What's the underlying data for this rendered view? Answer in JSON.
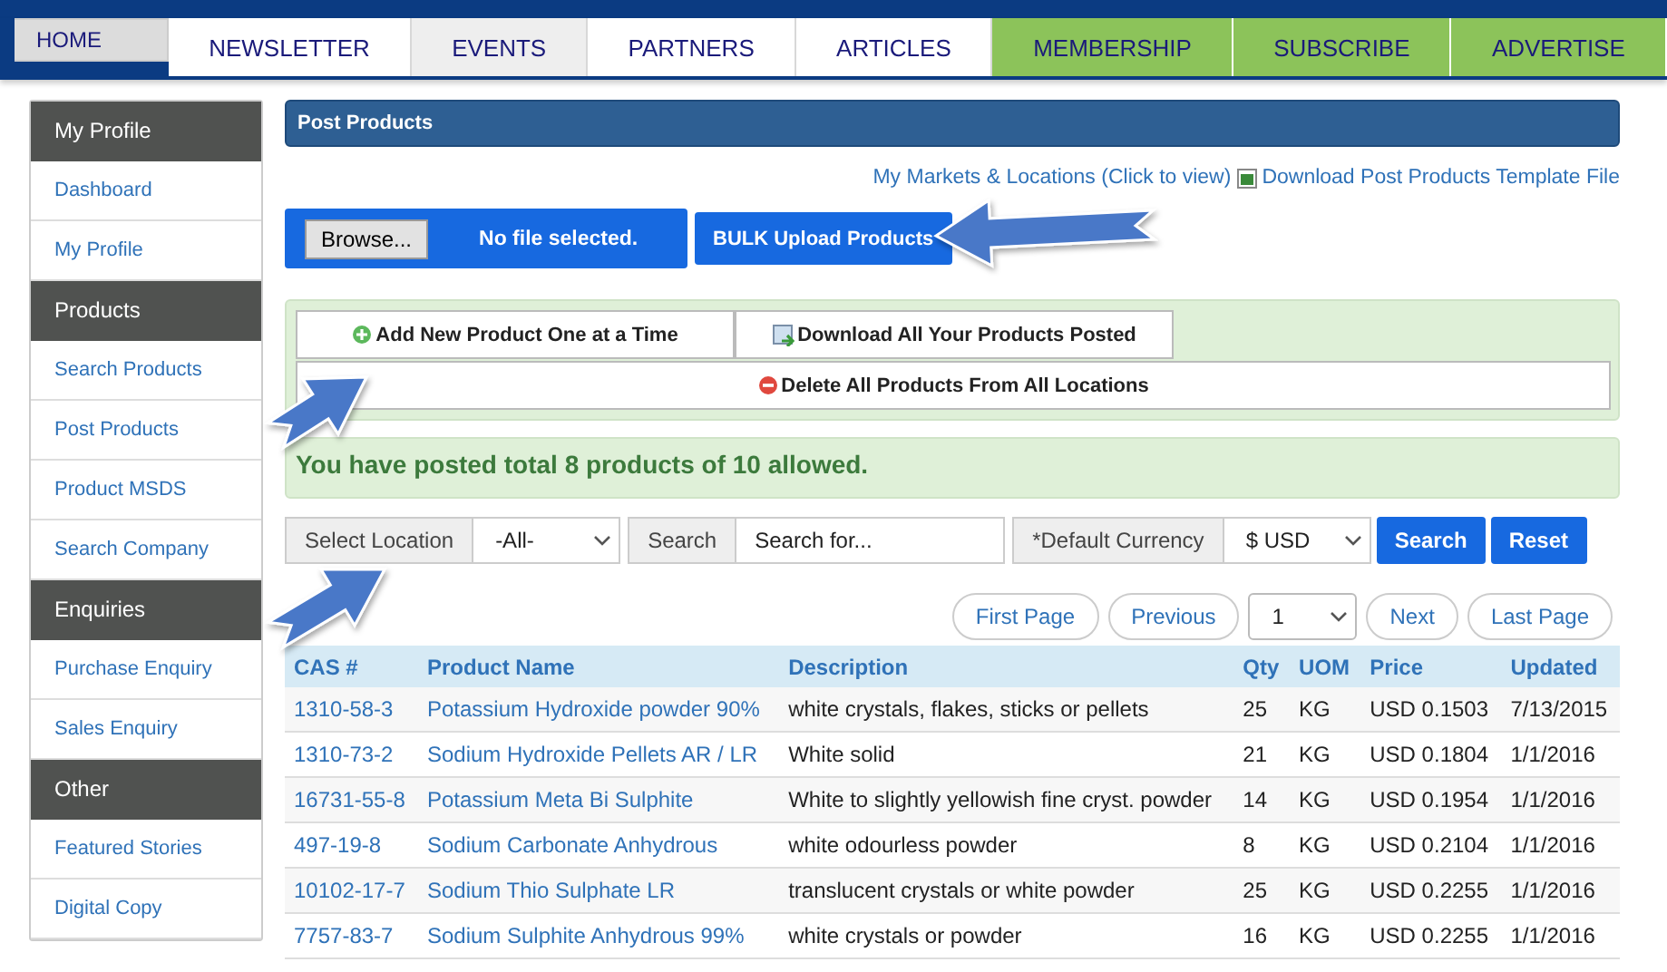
{
  "nav": [
    {
      "label": "HOME",
      "kind": "plain",
      "selected": true,
      "highlighted": false
    },
    {
      "label": "NEWSLETTER",
      "kind": "plain",
      "selected": false,
      "highlighted": false
    },
    {
      "label": "EVENTS",
      "kind": "plain",
      "selected": false,
      "highlighted": true
    },
    {
      "label": "PARTNERS",
      "kind": "plain",
      "selected": false,
      "highlighted": false
    },
    {
      "label": "ARTICLES",
      "kind": "plain",
      "selected": false,
      "highlighted": false
    },
    {
      "label": "MEMBERSHIP",
      "kind": "promo",
      "selected": false,
      "highlighted": false
    },
    {
      "label": "SUBSCRIBE",
      "kind": "promo",
      "selected": false,
      "highlighted": false
    },
    {
      "label": "ADVERTISE",
      "kind": "promo",
      "selected": false,
      "highlighted": false
    }
  ],
  "sidebar": [
    {
      "heading": "My Profile",
      "items": [
        "Dashboard",
        "My Profile"
      ]
    },
    {
      "heading": "Products",
      "items": [
        "Search Products",
        "Post Products",
        "Product MSDS",
        "Search Company"
      ]
    },
    {
      "heading": "Enquiries",
      "items": [
        "Purchase Enquiry",
        "Sales Enquiry"
      ]
    },
    {
      "heading": "Other",
      "items": [
        "Featured Stories",
        "Digital Copy"
      ]
    }
  ],
  "panel_title": "Post Products",
  "links": {
    "markets": "My Markets & Locations (Click to view)",
    "template": "Download Post Products Template File"
  },
  "upload": {
    "browse": "Browse...",
    "file_status": "No file selected.",
    "bulk_button": "BULK Upload Products"
  },
  "actions": [
    {
      "label": "Add New Product One at a Time",
      "kind": "add"
    },
    {
      "label": "Download All Your Products Posted",
      "kind": "download"
    },
    {
      "label": "Delete All Products From All Locations",
      "kind": "delete"
    }
  ],
  "message": "You have posted total 8 products of 10 allowed.",
  "filters": {
    "location_label": "Select Location",
    "location_value": "-All-",
    "search_label": "Search",
    "search_placeholder": "Search for...",
    "currency_label": "*Default Currency",
    "currency_value": "$ USD",
    "search_button": "Search",
    "reset_button": "Reset"
  },
  "pagination": {
    "first": "First Page",
    "previous": "Previous",
    "page": "1",
    "next": "Next",
    "last": "Last Page"
  },
  "table": {
    "columns": [
      "CAS #",
      "Product Name",
      "Description",
      "Qty",
      "UOM",
      "Price",
      "Updated"
    ],
    "rows": [
      [
        "1310-58-3",
        "Potassium Hydroxide powder 90%",
        "white crystals, flakes, sticks or pellets",
        "25",
        "KG",
        "USD 0.1503",
        "7/13/2015"
      ],
      [
        "1310-73-2",
        "Sodium Hydroxide Pellets AR / LR",
        "White solid",
        "21",
        "KG",
        "USD 0.1804",
        "1/1/2016"
      ],
      [
        "16731-55-8",
        "Potassium Meta Bi Sulphite",
        "White to slightly yellowish fine cryst. powder",
        "14",
        "KG",
        "USD 0.1954",
        "1/1/2016"
      ],
      [
        "497-19-8",
        "Sodium Carbonate Anhydrous",
        "white odourless powder",
        "8",
        "KG",
        "USD 0.2104",
        "1/1/2016"
      ],
      [
        "10102-17-7",
        "Sodium Thio Sulphate LR",
        "translucent crystals or white powder",
        "25",
        "KG",
        "USD 0.2255",
        "1/1/2016"
      ],
      [
        "7757-83-7",
        "Sodium Sulphite Anhydrous 99%",
        "white crystals or powder",
        "16",
        "KG",
        "USD 0.2255",
        "1/1/2016"
      ]
    ]
  }
}
